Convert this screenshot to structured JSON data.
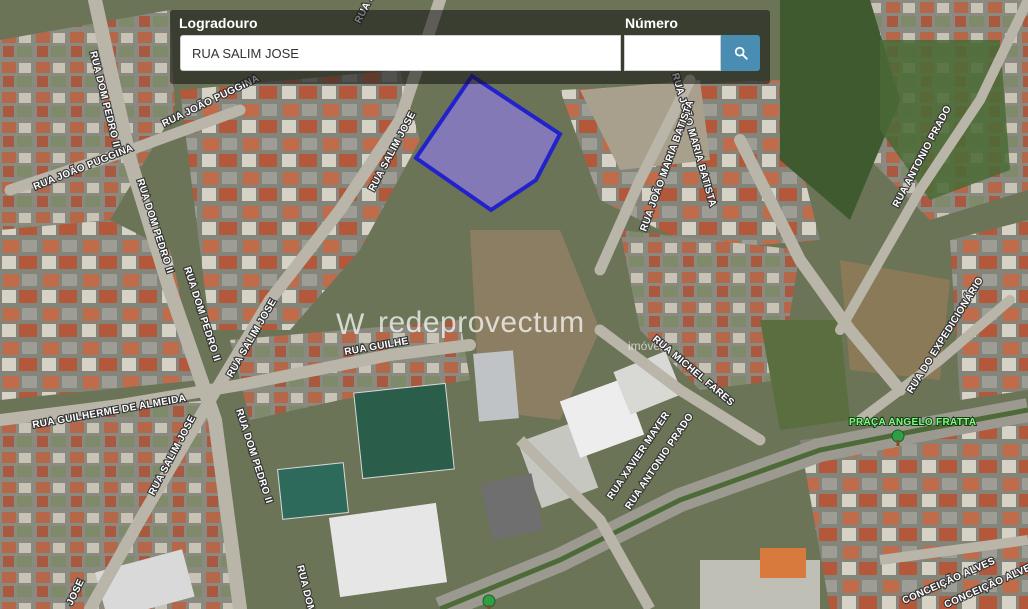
{
  "search": {
    "street_label": "Logradouro",
    "street_value": "RUA SALIM JOSE",
    "number_label": "Número",
    "number_value": "",
    "search_icon": "search-icon"
  },
  "map": {
    "highlight_color": "#2222cc",
    "highlight_fill": "#8a7ad0",
    "watermark": {
      "text": "redeprovectum",
      "sub": "imóveis"
    },
    "streets": {
      "joao_top": "RUA JOÃO",
      "dom_pedro_top": "RUA DOM PEDRO II",
      "joao_puggina_1": "RUA JOÃO PUGGINA",
      "joao_puggina_2": "RUA JOÃO PUGGINA",
      "dom_pedro_left": "RUA DOM PEDRO II",
      "salim_jose_top": "RUA SALIM JOSE",
      "joao_maria_batista_1": "RUA JOÃO MARIA BATISTA",
      "joao_maria_batista_2": "RUA JOÃO MARIA BATISTA",
      "antonio_prado_top": "RUA ANTONIO PRADO",
      "dom_pedro_mid": "RUA DOM PEDRO II",
      "salim_jose_mid": "RUA SALIM JOSE",
      "guilhe": "RUA GUILHE",
      "michel_fares": "RUA MICHEL FARES",
      "expedicionario": "RUA DO EXPEDICIONÁRIO",
      "guilherme_almeida": "RUA GUILHERME DE ALMEIDA",
      "salim_jose_bottom": "RUA SALIM JOSE",
      "dom_pedro_bottom": "RUA DOM PEDRO II",
      "xavier_mayer": "RUA XAVIER MAYER",
      "antonio_prado_bottom": "RUA ANTONIO PRADO",
      "dom_pedro_edge": "RUA DOM",
      "jose_edge": "JOSE",
      "conceicao_1": "CONCEIÇÃO ALVES",
      "conceicao_2": "CONCEIÇÃO ALVES"
    },
    "poi": {
      "praca_label": "PRAÇA ANGELO FRATTA",
      "praca_icon": "tree-marker-icon"
    }
  }
}
